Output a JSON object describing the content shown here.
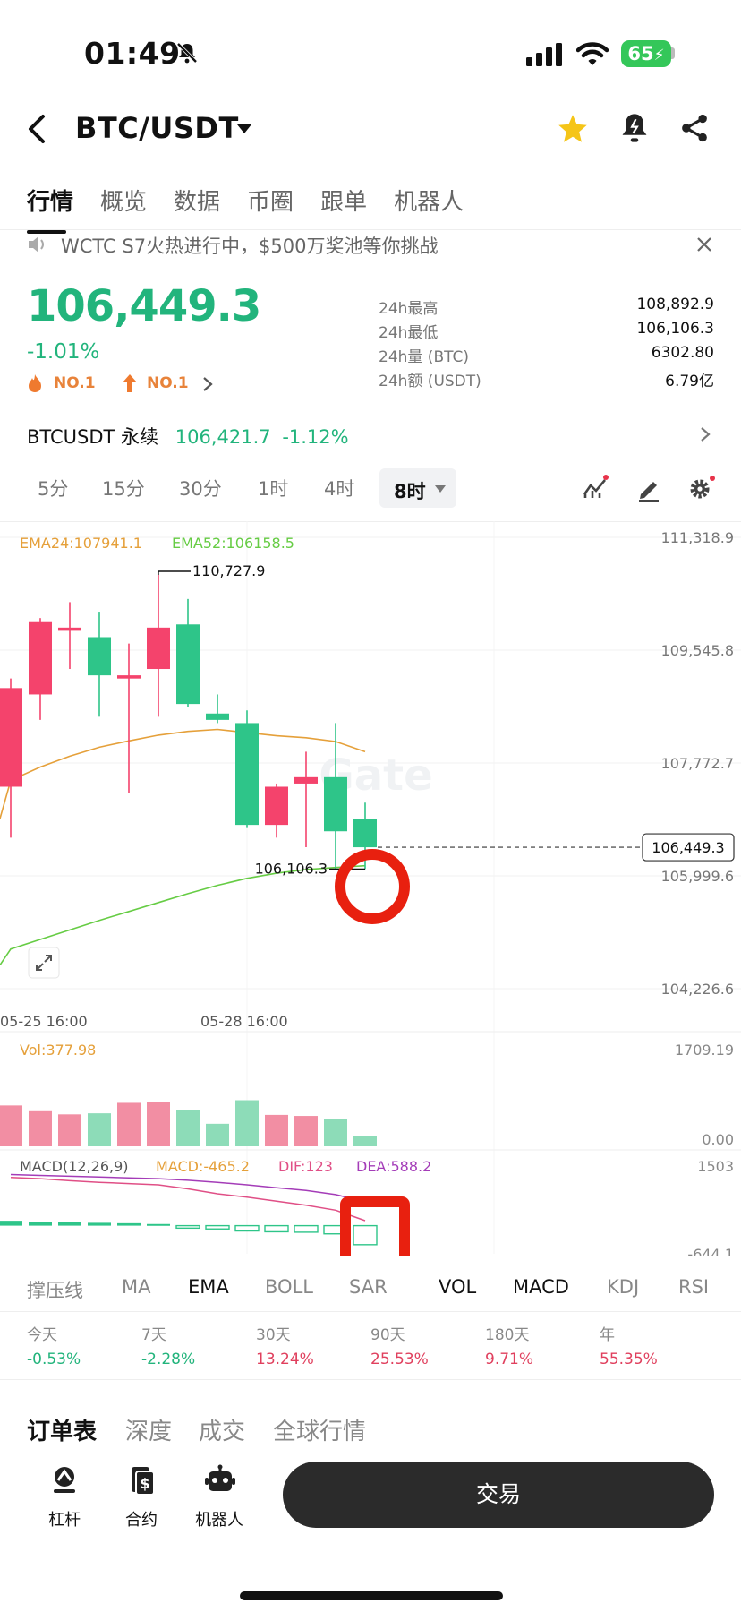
{
  "status_bar": {
    "time": "01:49",
    "battery": "65"
  },
  "header": {
    "title": "BTC/USDT"
  },
  "tabs": [
    {
      "label": "行情",
      "active": true
    },
    {
      "label": "概览"
    },
    {
      "label": "数据"
    },
    {
      "label": "币圈"
    },
    {
      "label": "跟单"
    },
    {
      "label": "机器人"
    }
  ],
  "notice": {
    "text": "WCTC S7火热进行中，$500万奖池等你挑战"
  },
  "ticker": {
    "price": "106,449.3",
    "change": "-1.01%",
    "rank1": "NO.1",
    "rank2": "NO.1",
    "stats": [
      {
        "label": "24h最高",
        "value": "108,892.9"
      },
      {
        "label": "24h最低",
        "value": "106,106.3"
      },
      {
        "label": "24h量 (BTC)",
        "value": "6302.80"
      },
      {
        "label": "24h额 (USDT)",
        "value": "6.79亿"
      }
    ],
    "perp_label": "BTCUSDT 永续",
    "perp_price": "106,421.7",
    "perp_change": "-1.12%"
  },
  "intervals": [
    "5分",
    "15分",
    "30分",
    "1时",
    "4时"
  ],
  "interval_active": "8时",
  "colors": {
    "up": "#f4436c",
    "down": "#2ec589",
    "ema24": "#e5a03a",
    "ema52": "#66cc44",
    "dif": "#e04f86",
    "dea": "#a43cb8"
  },
  "chart_data": {
    "type": "candlestick",
    "ema24_label": "EMA24:107941.1",
    "ema52_label": "EMA52:106158.5",
    "y_ticks": [
      "111,318.9",
      "109,545.8",
      "107,772.7",
      "105,999.6",
      "104,226.6"
    ],
    "ylim": [
      104226.6,
      111318.9
    ],
    "x_labels": [
      "05-25 16:00",
      "05-28 16:00"
    ],
    "high_label": "110,727.9",
    "low_label": "106,106.3",
    "current_price": "106,449.3",
    "watermark": "Gate",
    "candles": [
      {
        "o": 107400,
        "h": 109100,
        "l": 106600,
        "c": 108950,
        "up": true
      },
      {
        "o": 108850,
        "h": 110050,
        "l": 108450,
        "c": 110000,
        "up": true
      },
      {
        "o": 109900,
        "h": 110300,
        "l": 109250,
        "c": 109850,
        "up": true
      },
      {
        "o": 109750,
        "h": 110150,
        "l": 108500,
        "c": 109150,
        "up": false
      },
      {
        "o": 109100,
        "h": 109650,
        "l": 107300,
        "c": 109150,
        "up": true
      },
      {
        "o": 109250,
        "h": 110728,
        "l": 108500,
        "c": 109900,
        "up": true
      },
      {
        "o": 109950,
        "h": 110350,
        "l": 108650,
        "c": 108700,
        "up": false
      },
      {
        "o": 108550,
        "h": 108850,
        "l": 108400,
        "c": 108450,
        "up": false
      },
      {
        "o": 108400,
        "h": 108600,
        "l": 106750,
        "c": 106800,
        "up": false
      },
      {
        "o": 106800,
        "h": 107450,
        "l": 106600,
        "c": 107400,
        "up": true
      },
      {
        "o": 107450,
        "h": 107950,
        "l": 106450,
        "c": 107550,
        "up": true
      },
      {
        "o": 107550,
        "h": 108400,
        "l": 106106,
        "c": 106700,
        "up": false
      },
      {
        "o": 106900,
        "h": 107150,
        "l": 106106,
        "c": 106449,
        "up": false
      }
    ],
    "ema24": [
      107500,
      107710,
      107880,
      108020,
      108120,
      108210,
      108270,
      108300,
      108250,
      108200,
      108170,
      108110,
      107950
    ],
    "ema52": [
      104850,
      105000,
      105150,
      105300,
      105440,
      105580,
      105720,
      105850,
      105960,
      106040,
      106100,
      106130,
      106158
    ],
    "volume": {
      "label": "Vol:377.98",
      "y_ticks": [
        "1709.19",
        "0.00"
      ],
      "values": [
        780,
        670,
        610,
        630,
        830,
        850,
        690,
        430,
        880,
        600,
        580,
        520,
        200
      ]
    },
    "macd": {
      "label": "MACD(12,26,9)",
      "macd_label": "MACD:-465.2",
      "dif_label": "DIF:123",
      "dea_label": "DEA:588.2",
      "y_ticks": [
        "1503",
        "-644.1"
      ],
      "hist": [
        120,
        90,
        80,
        70,
        60,
        40,
        -60,
        -80,
        -130,
        -150,
        -160,
        -200,
        -465
      ],
      "dif": [
        1180,
        1150,
        1100,
        1060,
        1030,
        1000,
        900,
        780,
        700,
        600,
        500,
        380,
        123
      ],
      "dea": [
        1250,
        1230,
        1210,
        1190,
        1170,
        1150,
        1110,
        1060,
        1000,
        930,
        860,
        760,
        588
      ]
    }
  },
  "indicator_tabs": [
    {
      "label": "撑压线"
    },
    {
      "label": "MA"
    },
    {
      "label": "EMA",
      "active": true
    },
    {
      "label": "BOLL"
    },
    {
      "label": "SAR"
    },
    {
      "label": "VOL",
      "active": true
    },
    {
      "label": "MACD",
      "active": true
    },
    {
      "label": "KDJ"
    },
    {
      "label": "RSI"
    }
  ],
  "performance": [
    {
      "label": "今天",
      "value": "-0.53%",
      "dir": "down"
    },
    {
      "label": "7天",
      "value": "-2.28%",
      "dir": "down"
    },
    {
      "label": "30天",
      "value": "13.24%",
      "dir": "up"
    },
    {
      "label": "90天",
      "value": "25.53%",
      "dir": "up"
    },
    {
      "label": "180天",
      "value": "9.71%",
      "dir": "up"
    },
    {
      "label": "年",
      "value": "55.35%",
      "dir": "up"
    }
  ],
  "order_tabs": [
    {
      "label": "订单表",
      "active": true
    },
    {
      "label": "深度"
    },
    {
      "label": "成交"
    },
    {
      "label": "全球行情"
    }
  ],
  "bottom_bar": {
    "leverage": "杠杆",
    "contract": "合约",
    "bot": "机器人",
    "trade": "交易"
  }
}
